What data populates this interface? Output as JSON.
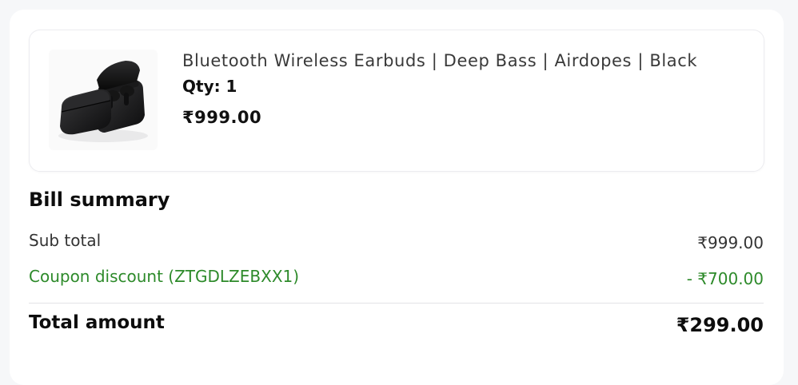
{
  "product": {
    "name": "Bluetooth Wireless Earbuds | Deep Bass | Airdopes | Black",
    "qty": "Qty: 1",
    "price": "₹999.00",
    "image_icon": "earbuds-case-image"
  },
  "bill": {
    "title": "Bill summary",
    "sub_total_label": "Sub total",
    "sub_total_value": "₹999.00",
    "coupon_label": "Coupon discount (ZTGDLZEBXX1)",
    "coupon_value": "- ₹700.00",
    "total_label": "Total amount",
    "total_value": "₹299.00"
  },
  "colors": {
    "discount": "#2d8a2a",
    "text": "#111111",
    "border": "#ececf0"
  }
}
